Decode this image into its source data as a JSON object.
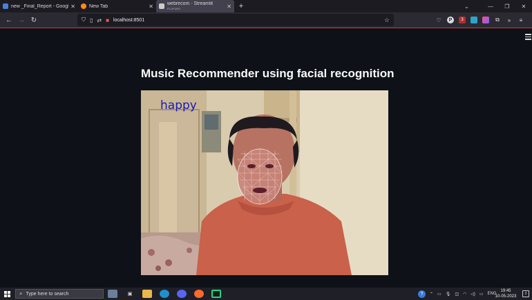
{
  "tabs": [
    {
      "title": "new _Final_Report - Google Do",
      "subtitle": "",
      "favicon_color": "#4a7fd8",
      "active": false
    },
    {
      "title": "New Tab",
      "subtitle": "",
      "favicon_color": "#ff8a1a",
      "active": false
    },
    {
      "title": "webrecom · Streamlit",
      "subtitle": "PLAYING",
      "favicon_color": "#cccccc",
      "active": true
    }
  ],
  "url": "localhost:8501",
  "app": {
    "title": "Music Recommender using facial recognition",
    "detected_emotion": "happy"
  },
  "taskbar": {
    "search_placeholder": "Type here to search",
    "language": "ENG",
    "time": "19:45",
    "date": "10-05-2023",
    "notification_count": "3"
  },
  "extension_badge": "3"
}
